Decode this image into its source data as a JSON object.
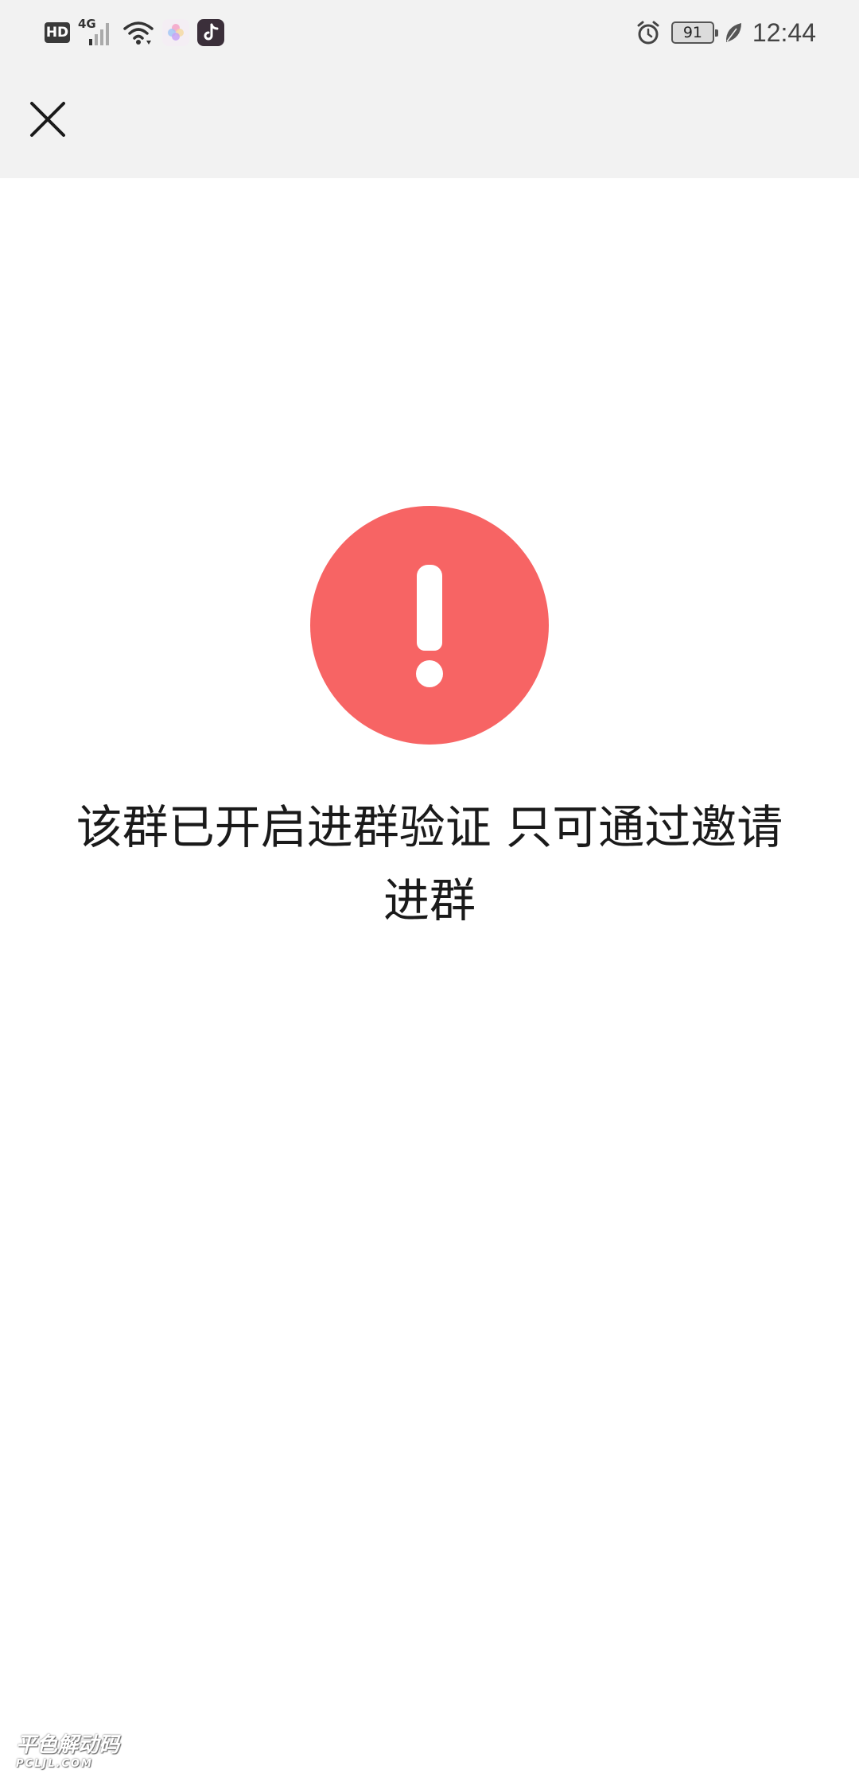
{
  "status_bar": {
    "hd_label": "HD",
    "network_label": "4G",
    "battery_level": "91",
    "time": "12:44",
    "icons": [
      "hd-icon",
      "signal-icon",
      "wifi-icon",
      "gallery-app-icon",
      "tiktok-app-icon",
      "alarm-icon",
      "battery-icon",
      "leaf-icon"
    ]
  },
  "header": {
    "close_icon": "close-icon"
  },
  "main": {
    "icon": "warning-icon",
    "icon_color": "#f76464",
    "message": "该群已开启进群验证 只可通过邀请进群"
  },
  "watermark": {
    "text": "平色解动码",
    "sub": "PCLJL.COM"
  }
}
